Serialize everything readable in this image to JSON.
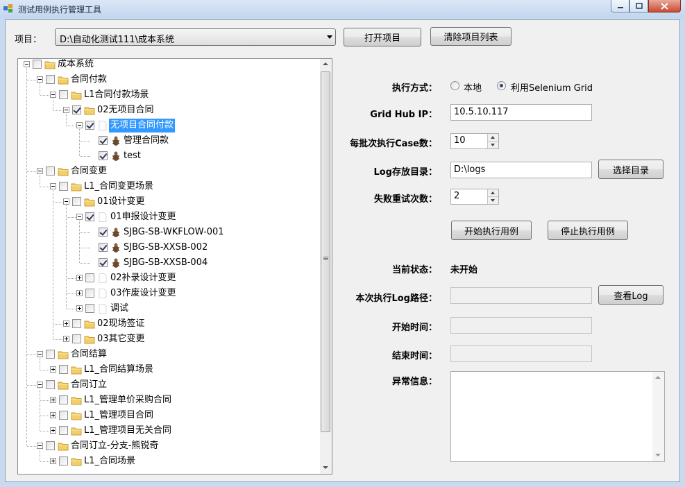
{
  "window": {
    "title": "测试用例执行管理工具"
  },
  "project": {
    "label": "项目：",
    "selected": "D:\\自动化测试111\\成本系统"
  },
  "toolbar": {
    "open_label": "打开项目",
    "clear_label": "清除项目列表"
  },
  "tree": {
    "nodes": [
      {
        "label": "成本系统",
        "level": 0,
        "checked": false,
        "expander": "minus",
        "icon": "folder"
      },
      {
        "label": "合同付款",
        "level": 1,
        "checked": false,
        "expander": "minus",
        "icon": "folder"
      },
      {
        "label": "L1合同付款场景",
        "level": 2,
        "checked": false,
        "expander": "minus",
        "icon": "folder"
      },
      {
        "label": "02无项目合同",
        "level": 3,
        "checked": true,
        "expander": "minus",
        "icon": "folder"
      },
      {
        "label": "无项目合同付款",
        "level": 4,
        "checked": true,
        "expander": "minus",
        "icon": "file",
        "selected": true
      },
      {
        "label": "管理合同款",
        "level": 5,
        "checked": true,
        "expander": "none",
        "icon": "bug"
      },
      {
        "label": "test",
        "level": 5,
        "checked": true,
        "expander": "none",
        "icon": "bug"
      },
      {
        "label": "合同变更",
        "level": 1,
        "checked": false,
        "expander": "minus",
        "icon": "folder"
      },
      {
        "label": "L1_合同变更场景",
        "level": 2,
        "checked": false,
        "expander": "minus",
        "icon": "folder"
      },
      {
        "label": "01设计变更",
        "level": 3,
        "checked": false,
        "expander": "minus",
        "icon": "folder"
      },
      {
        "label": "01申报设计变更",
        "level": 4,
        "checked": true,
        "expander": "minus",
        "icon": "file"
      },
      {
        "label": "SJBG-SB-WKFLOW-001",
        "level": 5,
        "checked": true,
        "expander": "none",
        "icon": "bug"
      },
      {
        "label": "SJBG-SB-XXSB-002",
        "level": 5,
        "checked": true,
        "expander": "none",
        "icon": "bug"
      },
      {
        "label": "SJBG-SB-XXSB-004",
        "level": 5,
        "checked": true,
        "expander": "none",
        "icon": "bug"
      },
      {
        "label": "02补录设计变更",
        "level": 4,
        "checked": false,
        "expander": "plus",
        "icon": "file"
      },
      {
        "label": "03作废设计变更",
        "level": 4,
        "checked": false,
        "expander": "plus",
        "icon": "file"
      },
      {
        "label": "调试",
        "level": 4,
        "checked": false,
        "expander": "plus",
        "icon": "file"
      },
      {
        "label": "02现场签证",
        "level": 3,
        "checked": false,
        "expander": "plus",
        "icon": "folder"
      },
      {
        "label": "03其它变更",
        "level": 3,
        "checked": false,
        "expander": "plus",
        "icon": "folder"
      },
      {
        "label": "合同结算",
        "level": 1,
        "checked": false,
        "expander": "minus",
        "icon": "folder"
      },
      {
        "label": "L1_合同结算场景",
        "level": 2,
        "checked": false,
        "expander": "plus",
        "icon": "folder"
      },
      {
        "label": "合同订立",
        "level": 1,
        "checked": false,
        "expander": "minus",
        "icon": "folder"
      },
      {
        "label": "L1_管理单价采购合同",
        "level": 2,
        "checked": false,
        "expander": "plus",
        "icon": "folder"
      },
      {
        "label": "L1_管理项目合同",
        "level": 2,
        "checked": false,
        "expander": "plus",
        "icon": "folder"
      },
      {
        "label": "L1_管理项目无关合同",
        "level": 2,
        "checked": false,
        "expander": "plus",
        "icon": "folder"
      },
      {
        "label": "合同订立-分支-熊锐奇",
        "level": 1,
        "checked": false,
        "expander": "minus",
        "icon": "folder"
      },
      {
        "label": "L1_合同场景",
        "level": 2,
        "checked": false,
        "expander": "plus",
        "icon": "folder"
      }
    ]
  },
  "settings": {
    "exec_mode_label": "执行方式：",
    "mode_local": "本地",
    "mode_grid": "利用Selenium Grid",
    "mode_selected": "grid",
    "hub_label": "Grid Hub IP：",
    "hub_value": "10.5.10.117",
    "batch_label": "每批次执行Case数：",
    "batch_value": "10",
    "logdir_label": "Log存放目录：",
    "logdir_value": "D:\\logs",
    "choose_dir": "选择目录",
    "retry_label": "失败重试次数：",
    "retry_value": "2",
    "start_btn": "开始执行用例",
    "stop_btn": "停止执行用例"
  },
  "status": {
    "state_label": "当前状态：",
    "state_value": "未开始",
    "logpath_label": "本次执行Log路径：",
    "view_log": "查看Log",
    "start_label": "开始时间：",
    "end_label": "结束时间：",
    "error_label": "异常信息："
  },
  "colors": {
    "selection": "#3399ff",
    "client_bg": "#f0f0f0",
    "titlebar": "#c9daf0"
  }
}
